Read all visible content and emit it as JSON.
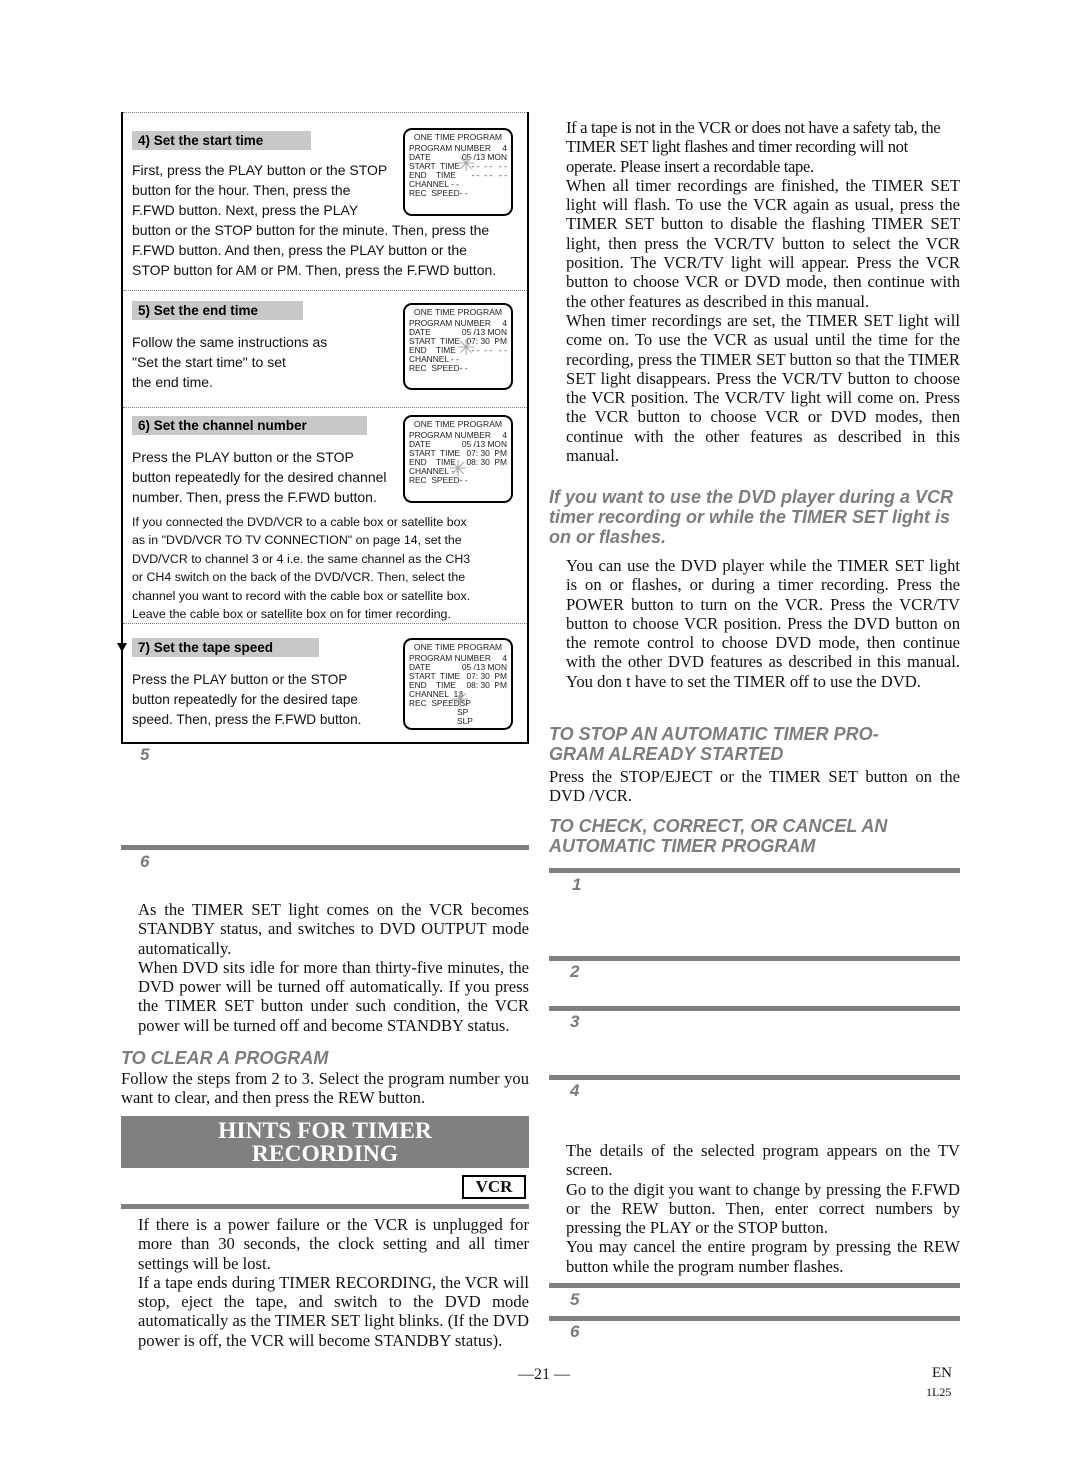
{
  "steps_panel": {
    "step4": {
      "title": "4) Set the start time",
      "text": "First, press the PLAY button or the STOP button for the hour. Then, press the F.FWD button.  Next, press the PLAY button or the STOP button for the minute. Then, press the F.FWD button.  And then, press the PLAY button or the STOP button for AM or PM. Then, press the F.FWD button.",
      "text_line1": "First, press the PLAY button or the STOP",
      "text_line2": "button for the hour. Then, press the",
      "text_line3": "F.FWD button.  Next, press the PLAY",
      "text_line4": "button or the STOP button for the minute. Then, press the",
      "text_line5": "F.FWD button.  And then, press the PLAY button or the",
      "text_line6": "STOP button for AM or PM. Then, press the F.FWD button.",
      "osd": {
        "title": "ONE TIME PROGRAM",
        "rows": [
          {
            "label": "PROGRAM NUMBER",
            "value": "4"
          },
          {
            "label": "DATE",
            "value": "05 /13 MON"
          },
          {
            "label": "START  TIME",
            "value": "- -  - -   - -"
          },
          {
            "label": "END    TIME",
            "value": "- -  - -   - -"
          },
          {
            "label": "CHANNEL",
            "value": "- -"
          },
          {
            "label": "REC  SPEED",
            "value": "- -"
          }
        ]
      }
    },
    "step5": {
      "title": "5) Set the end time",
      "text_line1": "Follow the same instructions as",
      "text_line2": "\"Set the start time\" to set",
      "text_line3": "the end time.",
      "osd": {
        "title": "ONE TIME PROGRAM",
        "rows": [
          {
            "label": "PROGRAM NUMBER",
            "value": "4"
          },
          {
            "label": "DATE",
            "value": "05 /13 MON"
          },
          {
            "label": "START  TIME",
            "value": "07: 30  PM"
          },
          {
            "label": "END    TIME",
            "value": "- -  - -   - -"
          },
          {
            "label": "CHANNEL",
            "value": "- -"
          },
          {
            "label": "REC  SPEED",
            "value": "- -"
          }
        ]
      }
    },
    "step6": {
      "title": "6) Set the channel number",
      "text_line1": "Press the PLAY button or the STOP",
      "text_line2": "button repeatedly for the desired channel",
      "text_line3": "number. Then, press the F.FWD button.",
      "osd": {
        "title": "ONE TIME PROGRAM",
        "rows": [
          {
            "label": "PROGRAM NUMBER",
            "value": "4"
          },
          {
            "label": "DATE",
            "value": "05 /13 MON"
          },
          {
            "label": "START  TIME",
            "value": "07: 30  PM"
          },
          {
            "label": "END    TIME",
            "value": "08: 30  PM"
          },
          {
            "label": "CHANNEL",
            "value": "- -"
          },
          {
            "label": "REC  SPEED",
            "value": "- -"
          }
        ]
      },
      "note_line1": "If you connected the DVD/VCR to a cable box or satellite box",
      "note_line2": "as in \"DVD/VCR TO TV CONNECTION\" on page 14, set the",
      "note_line3": "DVD/VCR to channel 3 or 4 i.e. the same channel as the CH3",
      "note_line4": "or CH4 switch on the back of the DVD/VCR.  Then, select the",
      "note_line5": "channel you want to record with the cable box or satellite box.",
      "note_line6": "Leave the cable box or satellite box on for timer recording."
    },
    "step7": {
      "title": "7) Set the tape speed",
      "text_line1": "Press the PLAY button or the STOP",
      "text_line2": "button repeatedly for the desired tape",
      "text_line3": "speed. Then, press the F.FWD button.",
      "osd": {
        "title": "ONE TIME PROGRAM",
        "rows": [
          {
            "label": "PROGRAM NUMBER",
            "value": "4"
          },
          {
            "label": "DATE",
            "value": "05 /13 MON"
          },
          {
            "label": "START  TIME",
            "value": "07: 30  PM"
          },
          {
            "label": "END    TIME",
            "value": "08: 30  PM"
          },
          {
            "label": "CHANNEL",
            "value": "13"
          },
          {
            "label": "REC  SPEED",
            "value": "SP"
          }
        ],
        "extra_options": [
          "SP",
          "SLP"
        ]
      }
    }
  },
  "left_column": {
    "step5_number": "5",
    "step6_number": "6",
    "step6_para1": "As the TIMER SET light comes on the VCR becomes STANDBY status, and switches to DVD OUTPUT mode automatically.",
    "step6_para2": "When DVD sits idle for more than thirty-five minutes, the DVD power will be turned off automatically.  If you press the TIMER SET button under such condition, the VCR power will be turned off and become STANDBY status.",
    "clear_heading": "TO CLEAR A PROGRAM",
    "clear_text": "Follow the steps from 2 to 3.  Select the program number you want to clear, and then press the REW button.",
    "hints_title_line1": "HINTS FOR TIMER",
    "hints_title_line2": "RECORDING",
    "vcr_badge": "VCR",
    "hints_para1": "If there is a power failure or the VCR is unplugged for more than 30 seconds, the clock setting and all timer settings will be lost.",
    "hints_para2": "If a tape ends during TIMER RECORDING, the VCR will stop, eject the tape, and switch to the DVD mode automatically as the TIMER SET light blinks. (If the DVD power is off, the VCR will become STANDBY status)."
  },
  "right_column": {
    "para1": "If a tape is not in the VCR or does not have a safety tab, the TIMER SET light flashes and timer recording will not operate. Please insert a recordable tape.",
    "para2": "When all timer recordings are finished, the TIMER SET light will flash. To use the VCR again as usual, press the TIMER SET button to disable the flashing TIMER SET light, then press the VCR/TV button to select the VCR position. The VCR/TV light will appear. Press the VCR button to choose VCR or DVD mode, then continue with the other features as described in this manual.",
    "para3": "When timer recordings are set, the TIMER SET light will come on. To use the VCR as usual until the time for the recording, press the TIMER SET button so that the TIMER SET light disappears. Press the VCR/TV button to choose the VCR position. The VCR/TV light will come on. Press the VCR button to choose VCR or DVD modes, then continue with the other features as described in this manual.",
    "dvd_heading": "If you want to use the DVD player during a VCR timer recording or while the TIMER SET light is on or flashes.",
    "dvd_text": "You can use the DVD player while the TIMER SET light is on or flashes, or during a timer recording. Press the POWER button to turn on the VCR. Press the VCR/TV button to choose VCR position. Press the DVD button on the remote control to choose DVD mode, then continue with the other DVD features as described in this manual. You don t have to set the TIMER off to use the DVD.",
    "stop_heading_line1": "TO STOP AN AUTOMATIC TIMER PRO-",
    "stop_heading_line2": "GRAM ALREADY STARTED",
    "stop_text": "Press the STOP/EJECT or the TIMER SET button on the DVD /VCR.",
    "check_heading_line1": "TO CHECK, CORRECT, OR CANCEL AN",
    "check_heading_line2": "AUTOMATIC TIMER PROGRAM",
    "step_numbers": [
      "1",
      "2",
      "3",
      "4",
      "5",
      "6"
    ],
    "step4_para1": "The details of the selected program appears on the TV screen.",
    "step4_para2": "Go to the digit you want to change by pressing the F.FWD or the REW button. Then, enter correct numbers by pressing the PLAY or the STOP button.",
    "step4_para3": "You may cancel the entire program by pressing the REW button while the program number flashes."
  },
  "footer": {
    "page_number": "—21 —",
    "language": "EN",
    "code": "1L25"
  }
}
